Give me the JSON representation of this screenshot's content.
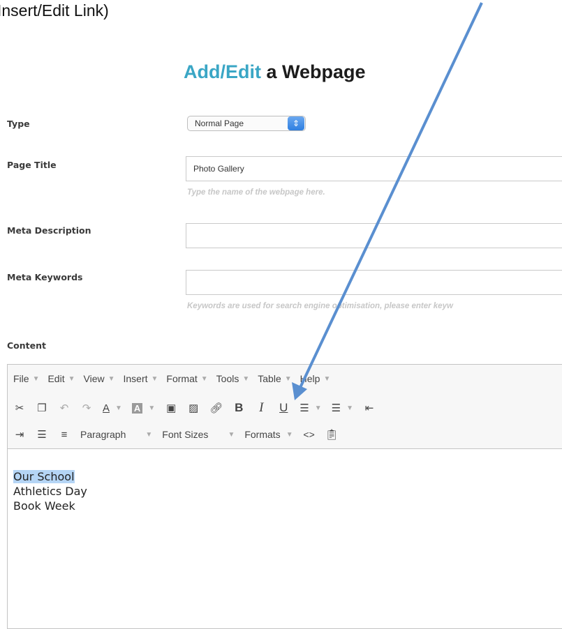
{
  "caption": "Insert/Edit Link)",
  "header": {
    "title_accent": "Add/Edit",
    "title_rest": " a Webpage"
  },
  "form": {
    "type_label": "Type",
    "type_value": "Normal Page",
    "page_title_label": "Page Title",
    "page_title_value": "Photo Gallery",
    "page_title_hint": "Type the name of the webpage here.",
    "meta_description_label": "Meta Description",
    "meta_keywords_label": "Meta Keywords",
    "meta_keywords_hint": "Keywords are used for search engine optimisation, please enter keyw",
    "content_label": "Content"
  },
  "editor": {
    "menu": [
      "File",
      "Edit",
      "View",
      "Insert",
      "Format",
      "Tools",
      "Table",
      "Help"
    ],
    "toolbar": {
      "paragraph": "Paragraph",
      "font_sizes": "Font Sizes",
      "formats": "Formats",
      "code": "<>"
    },
    "lines": [
      "Our School",
      "Athletics Day",
      "Book Week"
    ]
  },
  "annotation": {
    "arrow_color": "#5a8fd0"
  }
}
